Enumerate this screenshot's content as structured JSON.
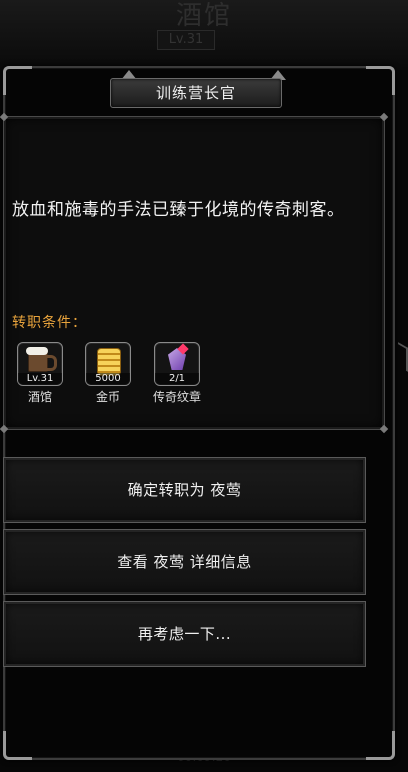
{
  "background": {
    "title": "酒馆",
    "level": "Lv.31",
    "timer": "00:09:26"
  },
  "dialog": {
    "title": "训练营长官",
    "description": "放血和施毒的手法已臻于化境的传奇刺客。",
    "requirements_label": "转职条件：",
    "requirements": [
      {
        "value": "Lv.31",
        "name": "酒馆",
        "icon": "beer-mug-icon"
      },
      {
        "value": "5000",
        "name": "金币",
        "icon": "gold-coins-icon"
      },
      {
        "value": "2/1",
        "name": "传奇纹章",
        "icon": "legendary-emblem-icon"
      }
    ]
  },
  "actions": {
    "confirm": "确定转职为 夜莺",
    "details": "查看 夜莺 详细信息",
    "cancel": "再考虑一下..."
  },
  "colors": {
    "accent_orange": "#e8a33c",
    "frame": "#3c3c3c",
    "text": "#f0f0f0"
  }
}
